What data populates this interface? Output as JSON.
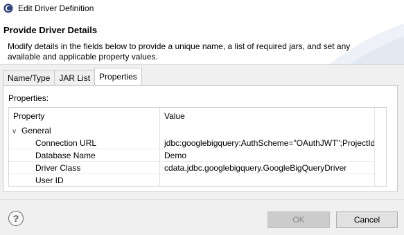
{
  "window": {
    "title": "Edit Driver Definition",
    "icon": "eclipse-icon"
  },
  "header": {
    "title": "Provide Driver Details",
    "description": "Modify details in the fields below to provide a unique name, a list of required jars, and set any available and applicable property values."
  },
  "tabs": [
    {
      "label": "Name/Type",
      "active": false
    },
    {
      "label": "JAR List",
      "active": false
    },
    {
      "label": "Properties",
      "active": true
    }
  ],
  "properties": {
    "section_label": "Properties:",
    "columns": [
      "Property",
      "Value"
    ],
    "group": {
      "label": "General",
      "expanded": true,
      "expander_icon": "chevron-down-icon"
    },
    "rows": [
      {
        "property": "Connection URL",
        "value": "jdbc:googlebigquery:AuthScheme=\"OAuthJWT\";ProjectId..."
      },
      {
        "property": "Database Name",
        "value": "Demo"
      },
      {
        "property": "Driver Class",
        "value": "cdata.jdbc.googlebigquery.GoogleBigQueryDriver"
      },
      {
        "property": "User ID",
        "value": ""
      }
    ]
  },
  "footer": {
    "help_icon": "question-mark-icon",
    "help_glyph": "?",
    "ok_label": "OK",
    "ok_enabled": false,
    "cancel_label": "Cancel"
  },
  "colors": {
    "accent": "#1f5fa8",
    "disabled_button": "#cccccc",
    "disabled_text": "#8a8a8a"
  }
}
